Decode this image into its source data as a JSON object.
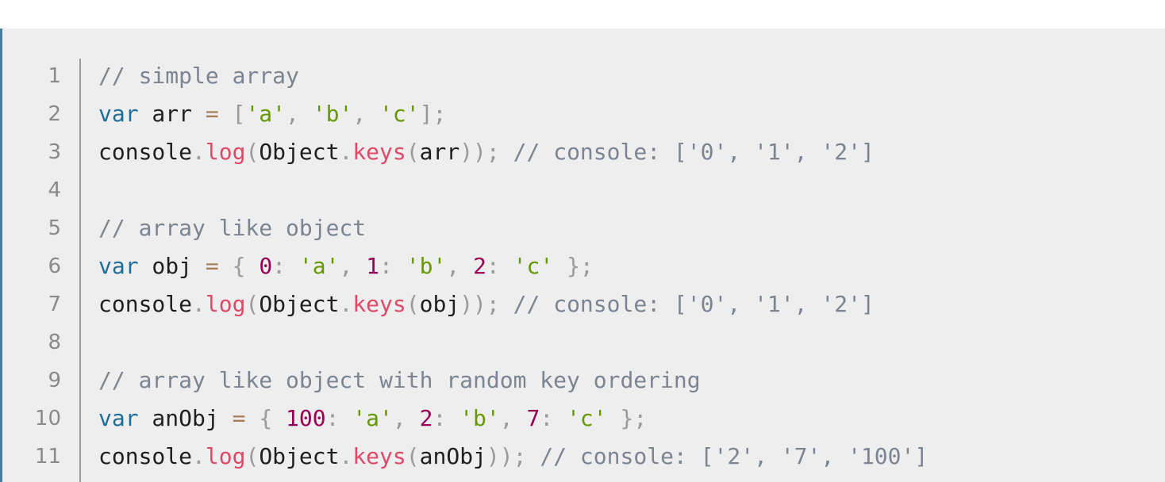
{
  "code_block": {
    "lines": [
      {
        "num": "1",
        "tokens": [
          {
            "t": "comment",
            "v": "// simple array"
          }
        ]
      },
      {
        "num": "2",
        "tokens": [
          {
            "t": "keyword",
            "v": "var"
          },
          {
            "t": "plain",
            "v": " arr "
          },
          {
            "t": "op",
            "v": "="
          },
          {
            "t": "plain",
            "v": " "
          },
          {
            "t": "punct",
            "v": "["
          },
          {
            "t": "string",
            "v": "'a'"
          },
          {
            "t": "punct",
            "v": ","
          },
          {
            "t": "plain",
            "v": " "
          },
          {
            "t": "string",
            "v": "'b'"
          },
          {
            "t": "punct",
            "v": ","
          },
          {
            "t": "plain",
            "v": " "
          },
          {
            "t": "string",
            "v": "'c'"
          },
          {
            "t": "punct",
            "v": "];"
          }
        ]
      },
      {
        "num": "3",
        "tokens": [
          {
            "t": "plain",
            "v": "console"
          },
          {
            "t": "punct",
            "v": "."
          },
          {
            "t": "func",
            "v": "log"
          },
          {
            "t": "punct",
            "v": "("
          },
          {
            "t": "plain",
            "v": "Object"
          },
          {
            "t": "punct",
            "v": "."
          },
          {
            "t": "func",
            "v": "keys"
          },
          {
            "t": "punct",
            "v": "("
          },
          {
            "t": "plain",
            "v": "arr"
          },
          {
            "t": "punct",
            "v": "));"
          },
          {
            "t": "plain",
            "v": " "
          },
          {
            "t": "comment",
            "v": "// console: ['0', '1', '2']"
          }
        ]
      },
      {
        "num": "4",
        "tokens": []
      },
      {
        "num": "5",
        "tokens": [
          {
            "t": "comment",
            "v": "// array like object"
          }
        ]
      },
      {
        "num": "6",
        "tokens": [
          {
            "t": "keyword",
            "v": "var"
          },
          {
            "t": "plain",
            "v": " obj "
          },
          {
            "t": "op",
            "v": "="
          },
          {
            "t": "plain",
            "v": " "
          },
          {
            "t": "punct",
            "v": "{"
          },
          {
            "t": "plain",
            "v": " "
          },
          {
            "t": "number",
            "v": "0"
          },
          {
            "t": "punct",
            "v": ":"
          },
          {
            "t": "plain",
            "v": " "
          },
          {
            "t": "string",
            "v": "'a'"
          },
          {
            "t": "punct",
            "v": ","
          },
          {
            "t": "plain",
            "v": " "
          },
          {
            "t": "number",
            "v": "1"
          },
          {
            "t": "punct",
            "v": ":"
          },
          {
            "t": "plain",
            "v": " "
          },
          {
            "t": "string",
            "v": "'b'"
          },
          {
            "t": "punct",
            "v": ","
          },
          {
            "t": "plain",
            "v": " "
          },
          {
            "t": "number",
            "v": "2"
          },
          {
            "t": "punct",
            "v": ":"
          },
          {
            "t": "plain",
            "v": " "
          },
          {
            "t": "string",
            "v": "'c'"
          },
          {
            "t": "plain",
            "v": " "
          },
          {
            "t": "punct",
            "v": "};"
          }
        ]
      },
      {
        "num": "7",
        "tokens": [
          {
            "t": "plain",
            "v": "console"
          },
          {
            "t": "punct",
            "v": "."
          },
          {
            "t": "func",
            "v": "log"
          },
          {
            "t": "punct",
            "v": "("
          },
          {
            "t": "plain",
            "v": "Object"
          },
          {
            "t": "punct",
            "v": "."
          },
          {
            "t": "func",
            "v": "keys"
          },
          {
            "t": "punct",
            "v": "("
          },
          {
            "t": "plain",
            "v": "obj"
          },
          {
            "t": "punct",
            "v": "));"
          },
          {
            "t": "plain",
            "v": " "
          },
          {
            "t": "comment",
            "v": "// console: ['0', '1', '2']"
          }
        ]
      },
      {
        "num": "8",
        "tokens": []
      },
      {
        "num": "9",
        "tokens": [
          {
            "t": "comment",
            "v": "// array like object with random key ordering"
          }
        ]
      },
      {
        "num": "10",
        "tokens": [
          {
            "t": "keyword",
            "v": "var"
          },
          {
            "t": "plain",
            "v": " anObj "
          },
          {
            "t": "op",
            "v": "="
          },
          {
            "t": "plain",
            "v": " "
          },
          {
            "t": "punct",
            "v": "{"
          },
          {
            "t": "plain",
            "v": " "
          },
          {
            "t": "number",
            "v": "100"
          },
          {
            "t": "punct",
            "v": ":"
          },
          {
            "t": "plain",
            "v": " "
          },
          {
            "t": "string",
            "v": "'a'"
          },
          {
            "t": "punct",
            "v": ","
          },
          {
            "t": "plain",
            "v": " "
          },
          {
            "t": "number",
            "v": "2"
          },
          {
            "t": "punct",
            "v": ":"
          },
          {
            "t": "plain",
            "v": " "
          },
          {
            "t": "string",
            "v": "'b'"
          },
          {
            "t": "punct",
            "v": ","
          },
          {
            "t": "plain",
            "v": " "
          },
          {
            "t": "number",
            "v": "7"
          },
          {
            "t": "punct",
            "v": ":"
          },
          {
            "t": "plain",
            "v": " "
          },
          {
            "t": "string",
            "v": "'c'"
          },
          {
            "t": "plain",
            "v": " "
          },
          {
            "t": "punct",
            "v": "};"
          }
        ]
      },
      {
        "num": "11",
        "tokens": [
          {
            "t": "plain",
            "v": "console"
          },
          {
            "t": "punct",
            "v": "."
          },
          {
            "t": "func",
            "v": "log"
          },
          {
            "t": "punct",
            "v": "("
          },
          {
            "t": "plain",
            "v": "Object"
          },
          {
            "t": "punct",
            "v": "."
          },
          {
            "t": "func",
            "v": "keys"
          },
          {
            "t": "punct",
            "v": "("
          },
          {
            "t": "plain",
            "v": "anObj"
          },
          {
            "t": "punct",
            "v": "));"
          },
          {
            "t": "plain",
            "v": " "
          },
          {
            "t": "comment",
            "v": "// console: ['2', '7', '100']"
          }
        ]
      }
    ]
  }
}
